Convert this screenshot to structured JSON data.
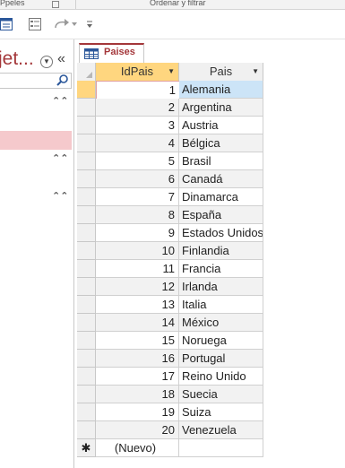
{
  "ribbon": {
    "group_left_label": "Ppeles",
    "group_right_label": "Ordenar y filtrar"
  },
  "nav_pane": {
    "title": "Todos los objet...",
    "title_visible": "jet..."
  },
  "document_tab": {
    "label": "Paises"
  },
  "datasheet": {
    "columns": [
      {
        "label": "IdPais"
      },
      {
        "label": "Pais"
      }
    ],
    "rows": [
      {
        "id": "1",
        "pais": "Alemania"
      },
      {
        "id": "2",
        "pais": "Argentina"
      },
      {
        "id": "3",
        "pais": "Austria"
      },
      {
        "id": "4",
        "pais": "Bélgica"
      },
      {
        "id": "5",
        "pais": "Brasil"
      },
      {
        "id": "6",
        "pais": "Canadá"
      },
      {
        "id": "7",
        "pais": "Dinamarca"
      },
      {
        "id": "8",
        "pais": "España"
      },
      {
        "id": "9",
        "pais": "Estados Unidos"
      },
      {
        "id": "10",
        "pais": "Finlandia"
      },
      {
        "id": "11",
        "pais": "Francia"
      },
      {
        "id": "12",
        "pais": "Irlanda"
      },
      {
        "id": "13",
        "pais": "Italia"
      },
      {
        "id": "14",
        "pais": "México"
      },
      {
        "id": "15",
        "pais": "Noruega"
      },
      {
        "id": "16",
        "pais": "Portugal"
      },
      {
        "id": "17",
        "pais": "Reino Unido"
      },
      {
        "id": "18",
        "pais": "Suecia"
      },
      {
        "id": "19",
        "pais": "Suiza"
      },
      {
        "id": "20",
        "pais": "Venezuela"
      }
    ],
    "new_row_symbol": "✱",
    "new_row_label": "(Nuevo)"
  },
  "colors": {
    "accent": "#a4373a",
    "header_selected": "#ffd67f",
    "cell_selected": "#cce4f7",
    "nav_selected": "#f5c9cc"
  }
}
